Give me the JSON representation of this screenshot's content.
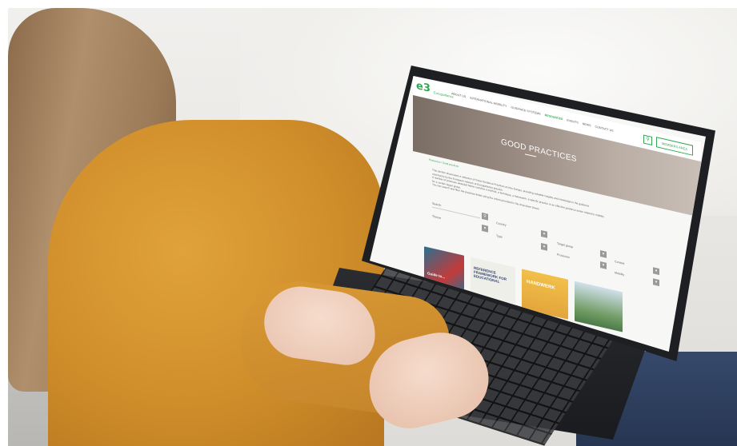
{
  "site": {
    "logo_text": "e3",
    "logo_sub": "Euroguidance",
    "nav": [
      "ABOUT US",
      "INTERNATIONAL MOBILITY",
      "GUIDANCE SYSTEMS",
      "RESOURCES",
      "EVENTS",
      "NEWS",
      "CONTACT US"
    ],
    "active_nav_index": 3,
    "search_icon": "search-icon",
    "members_label": "MEMBERS AREA"
  },
  "hero": {
    "title": "GOOD PRACTICES"
  },
  "breadcrumb": "Resources / Good practices",
  "intro": [
    "This section showcases a selection of Good Guidance Practices across Europe, providing valuable insights and knowledge to the guidance",
    "community by the European network of Euroguidance practice.",
    "A number of practices awarded below could be a method, a technique, a framework, a specific practice or an effective guidance action related to mobility",
    "for a certain target group.",
    "You can search and filter the practices listed using the criteria provided in the drop down boxes."
  ],
  "filters": {
    "search": "Search",
    "theme": "Theme",
    "country": "Country",
    "type": "Type",
    "target_group": "Target group",
    "provinces": "Provinces",
    "context": "Context",
    "mobility": "Mobility"
  },
  "cards": [
    {
      "title": "Guide to..."
    },
    {
      "title": "REFERENCE FRAMEWORK FOR EDUCATIONAL"
    },
    {
      "title": "HANDWERK"
    },
    {
      "title": ""
    }
  ],
  "colors": {
    "accent": "#2fa84f",
    "sweater": "#d08e2a",
    "jeans": "#2a3b58"
  }
}
